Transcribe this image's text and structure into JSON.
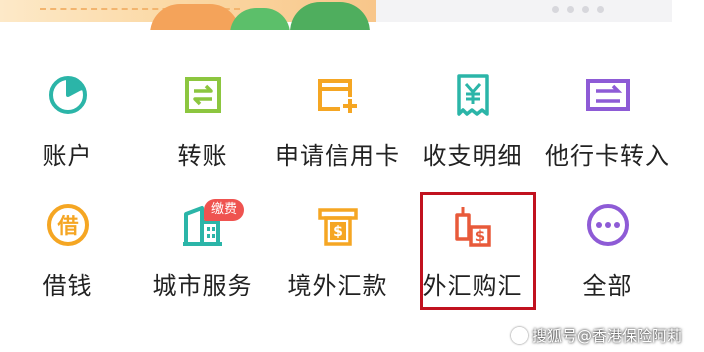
{
  "menu": {
    "row1": [
      {
        "label": "账户",
        "icon": "pie-chart-icon"
      },
      {
        "label": "转账",
        "icon": "transfer-icon"
      },
      {
        "label": "申请信用卡",
        "icon": "credit-card-add-icon"
      },
      {
        "label": "收支明细",
        "icon": "receipt-yuan-icon"
      },
      {
        "label": "他行卡转入",
        "icon": "card-transfer-in-icon"
      }
    ],
    "row2": [
      {
        "label": "借钱",
        "icon": "borrow-coin-icon"
      },
      {
        "label": "城市服务",
        "icon": "city-building-icon",
        "badge": "缴费"
      },
      {
        "label": "境外汇款",
        "icon": "overseas-remit-icon"
      },
      {
        "label": "外汇购汇",
        "icon": "forex-purchase-icon"
      },
      {
        "label": "全部",
        "icon": "more-dots-icon"
      }
    ]
  },
  "watermark": {
    "text": "搜狐号@香港保险阿莉"
  },
  "colors": {
    "teal": "#2bb5a8",
    "green": "#8cc63f",
    "orange": "#f5a623",
    "red": "#e85a3a",
    "purple": "#8e5bd6",
    "highlight": "#c1121f",
    "badge": "#ef5350"
  }
}
